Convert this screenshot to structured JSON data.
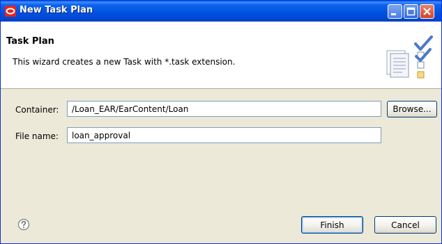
{
  "window": {
    "title": "New Task Plan"
  },
  "banner": {
    "title": "Task Plan",
    "description": "This wizard creates a new Task with *.task extension."
  },
  "form": {
    "container_label": "Container:",
    "container_value": "/Loan_EAR/EarContent/Loan",
    "browse_label": "Browse...",
    "filename_label": "File name:",
    "filename_value": "loan_approval"
  },
  "footer": {
    "finish_label": "Finish",
    "cancel_label": "Cancel"
  },
  "colors": {
    "titlebar": "#0050e0",
    "close_button": "#d1452a",
    "dialog_background": "#ece9d8",
    "field_border": "#7f9db9"
  },
  "icons": {
    "title": "oracle-logo-icon",
    "banner": "task-checklist-icon",
    "help": "help-icon",
    "minimize": "minimize-icon",
    "maximize": "maximize-icon",
    "close": "close-icon"
  }
}
